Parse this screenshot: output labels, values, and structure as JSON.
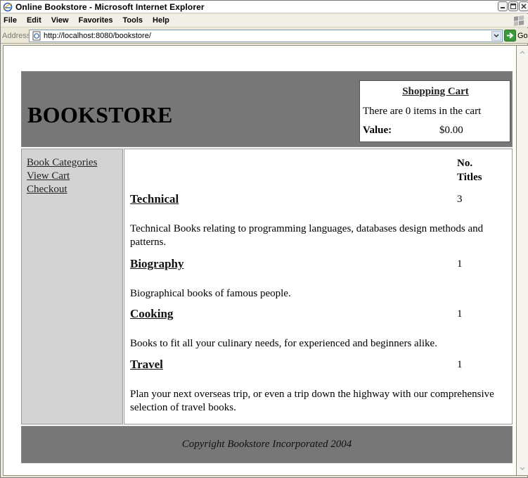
{
  "window": {
    "title": "Online Bookstore - Microsoft Internet Explorer"
  },
  "menu": {
    "items": [
      "File",
      "Edit",
      "View",
      "Favorites",
      "Tools",
      "Help"
    ]
  },
  "address_bar": {
    "label": "Address",
    "url": "http://localhost:8080/bookstore/",
    "go_label": "Go"
  },
  "page": {
    "site_title": "BOOKSTORE",
    "cart": {
      "title": "Shopping Cart",
      "items_text": "There are 0 items in the cart",
      "value_label": "Value:",
      "value": "$0.00"
    },
    "sidebar": {
      "links": [
        "Book Categories",
        "View Cart",
        "Checkout"
      ]
    },
    "table": {
      "count_header_line1": "No.",
      "count_header_line2": "Titles",
      "categories": [
        {
          "name": "Technical",
          "count": "3",
          "description": "Technical Books relating to programming languages, databases design methods and patterns."
        },
        {
          "name": "Biography",
          "count": "1",
          "description": "Biographical books of famous people."
        },
        {
          "name": "Cooking",
          "count": "1",
          "description": "Books to fit all your culinary needs, for experienced and beginners alike."
        },
        {
          "name": "Travel",
          "count": "1",
          "description": "Plan your next overseas trip, or even a trip down the highway with our comprehensive selection of travel books."
        }
      ]
    },
    "footer": {
      "copyright": "Copyright Bookstore Incorporated 2004"
    }
  },
  "colors": {
    "header_bg": "#777777",
    "sidebar_bg": "#d3d3d3",
    "chrome_bg": "#ece9d8"
  }
}
